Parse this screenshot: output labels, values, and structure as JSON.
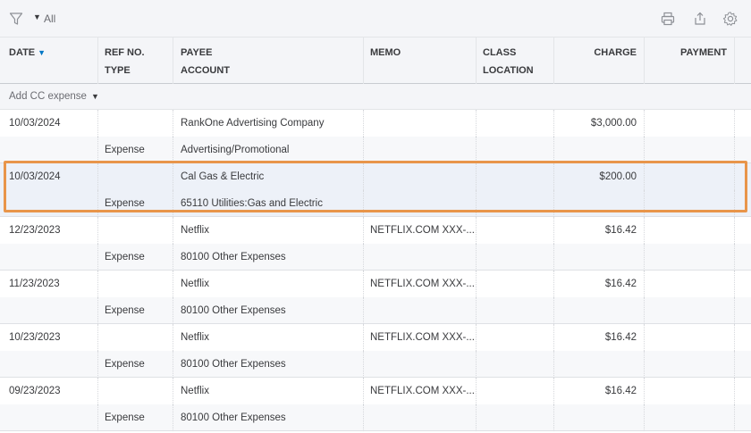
{
  "toolbar": {
    "filter_icon": "filter-funnel-icon",
    "filter_value": "All",
    "print_icon": "print-icon",
    "export_icon": "export-icon",
    "settings_icon": "gear-icon"
  },
  "columns": {
    "date": "DATE",
    "ref_no": "REF NO.",
    "type": "TYPE",
    "payee": "PAYEE",
    "account": "ACCOUNT",
    "memo": "MEMO",
    "class": "CLASS",
    "location": "LOCATION",
    "charge": "CHARGE",
    "payment": "PAYMENT"
  },
  "add_action": {
    "label": "Add CC expense"
  },
  "highlight_color": "#e8954a",
  "transactions": [
    {
      "date": "10/03/2024",
      "type": "Expense",
      "payee": "RankOne Advertising Company",
      "account": "Advertising/Promotional",
      "memo": "",
      "charge": "$3,000.00",
      "payment": ""
    },
    {
      "date": "10/03/2024",
      "type": "Expense",
      "payee": "Cal Gas & Electric",
      "account": "65110 Utilities:Gas and Electric",
      "memo": "",
      "charge": "$200.00",
      "payment": ""
    },
    {
      "date": "12/23/2023",
      "type": "Expense",
      "payee": "Netflix",
      "account": "80100 Other Expenses",
      "memo": "NETFLIX.COM XXX-...",
      "charge": "$16.42",
      "payment": ""
    },
    {
      "date": "11/23/2023",
      "type": "Expense",
      "payee": "Netflix",
      "account": "80100 Other Expenses",
      "memo": "NETFLIX.COM XXX-...",
      "charge": "$16.42",
      "payment": ""
    },
    {
      "date": "10/23/2023",
      "type": "Expense",
      "payee": "Netflix",
      "account": "80100 Other Expenses",
      "memo": "NETFLIX.COM XXX-...",
      "charge": "$16.42",
      "payment": ""
    },
    {
      "date": "09/23/2023",
      "type": "Expense",
      "payee": "Netflix",
      "account": "80100 Other Expenses",
      "memo": "NETFLIX.COM XXX-...",
      "charge": "$16.42",
      "payment": ""
    }
  ]
}
